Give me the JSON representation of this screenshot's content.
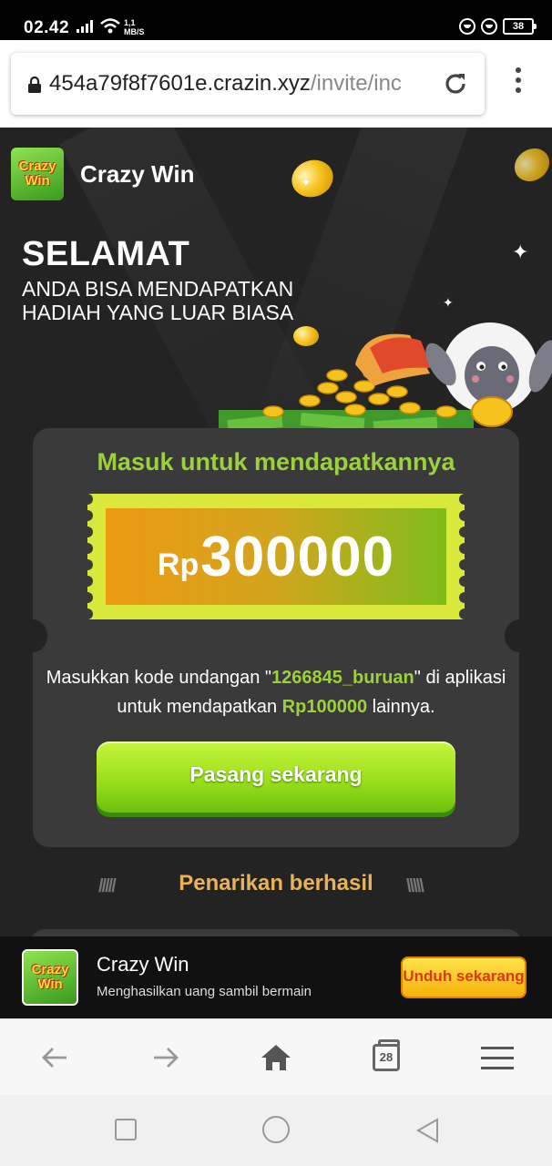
{
  "status_bar": {
    "time": "02.42",
    "net_speed_value": "1,1",
    "net_speed_unit": "MB/S",
    "battery": "38"
  },
  "browser": {
    "url_host": "454a79f8f7601e.crazin.xyz",
    "url_path": "/invite/inc"
  },
  "header": {
    "app_name": "Crazy Win",
    "logo_line1": "Crazy",
    "logo_line2": "Win"
  },
  "hero": {
    "headline": "SELAMAT",
    "subline": "ANDA BISA MENDAPATKAN HADIAH YANG LUAR BIASA"
  },
  "card": {
    "title": "Masuk untuk mendapatkannya",
    "currency": "Rp",
    "amount": "300000",
    "invite_prefix": "Masukkan kode undangan \"",
    "invite_code": "1266845_buruan",
    "invite_middle": "\" di aplikasi untuk mendapatkan ",
    "bonus_amount": "Rp100000",
    "invite_suffix": " lainnya.",
    "install_button": "Pasang sekarang"
  },
  "withdrawals": {
    "title": "Penarikan berhasil",
    "left_decor": "/////",
    "right_decor": "\\\\\\\\\\"
  },
  "download_banner": {
    "app_name": "Crazy Win",
    "tagline": "Menghasilkan uang sambil bermain",
    "button": "Unduh sekarang",
    "logo_line1": "Crazy",
    "logo_line2": "Win"
  },
  "toolbar": {
    "tab_count": "28"
  },
  "colors": {
    "accent_green": "#9bd13c",
    "gold": "#e7b25a",
    "page_bg": "#232323",
    "card_bg": "#3a3a3a"
  },
  "icons": [
    "lock-icon",
    "reload-icon",
    "back-arrow-icon",
    "forward-arrow-icon",
    "home-icon",
    "tabs-icon",
    "hamburger-menu-icon"
  ]
}
